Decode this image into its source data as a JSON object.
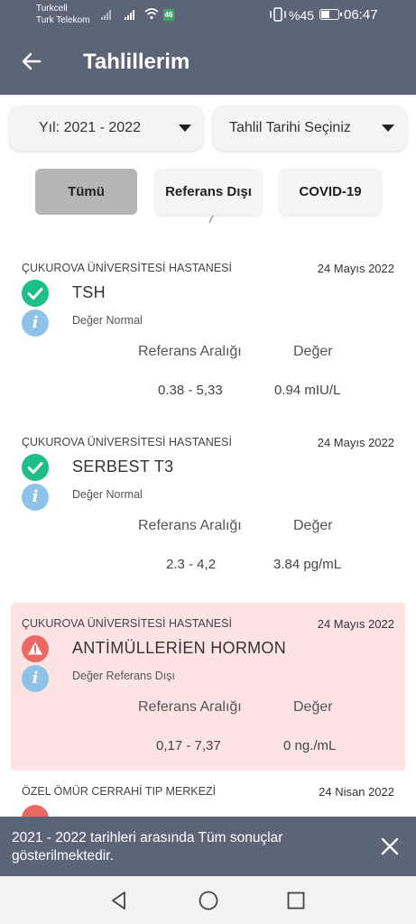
{
  "status_bar": {
    "carrier1": "Turkcell",
    "carrier2": "Turk Telekom",
    "battery_percent": "%45",
    "battery_level": 0.45,
    "time": "06:47",
    "app_badge": "46"
  },
  "header": {
    "title": "Tahlillerim",
    "back_icon": "arrow-left-icon",
    "color": "#5c6478"
  },
  "filters": {
    "year_dropdown": "Yıl: 2021 - 2022",
    "date_dropdown": "Tahlil Tarihi Seçiniz"
  },
  "tabs": [
    {
      "label": "Tümü",
      "active": true
    },
    {
      "label": "Referans Dışı",
      "active": false
    },
    {
      "label": "COVID-19",
      "active": false
    }
  ],
  "results": [
    {
      "hospital": "ÇUKUROVA ÜNİVERSİTESİ HASTANESİ",
      "date": "24 Mayıs 2022",
      "test": "TSH",
      "status": "Değer Normal",
      "status_icon": "check-icon",
      "ref_header": "Referans Aralığı",
      "value_header": "Değer",
      "ref_range": "0.38 - 5,33",
      "value": "0.94 mIU/L",
      "abnormal": false
    },
    {
      "hospital": "ÇUKUROVA ÜNİVERSİTESİ HASTANESİ",
      "date": "24 Mayıs 2022",
      "test": "SERBEST T3",
      "status": "Değer Normal",
      "status_icon": "check-icon",
      "ref_header": "Referans Aralığı",
      "value_header": "Değer",
      "ref_range": "2.3 - 4,2",
      "value": "3.84 pg/mL",
      "abnormal": false
    },
    {
      "hospital": "ÇUKUROVA ÜNİVERSİTESİ HASTANESİ",
      "date": "24 Mayıs 2022",
      "test": "ANTİMÜLLERİEN HORMON",
      "status": "Değer Referans Dışı",
      "status_icon": "warning-icon",
      "ref_header": "Referans Aralığı",
      "value_header": "Değer",
      "ref_range": "0,17 - 7,37",
      "value": "0 ng./mL",
      "abnormal": true
    },
    {
      "hospital": "ÖZEL ÖMÜR CERRAHİ TIP MERKEZİ",
      "date": "24 Nisan 2022",
      "status_icon": "warning-icon",
      "abnormal": true
    }
  ],
  "snackbar": {
    "message": "2021 - 2022 tarihleri arasında Tüm sonuçlar gösterilmektedir.",
    "close_icon": "close-icon"
  },
  "colors": {
    "ok": "#1dbe8a",
    "warning": "#ea6a63",
    "info": "#8ec2e9",
    "abnormal_bg": "#fde3e3"
  }
}
